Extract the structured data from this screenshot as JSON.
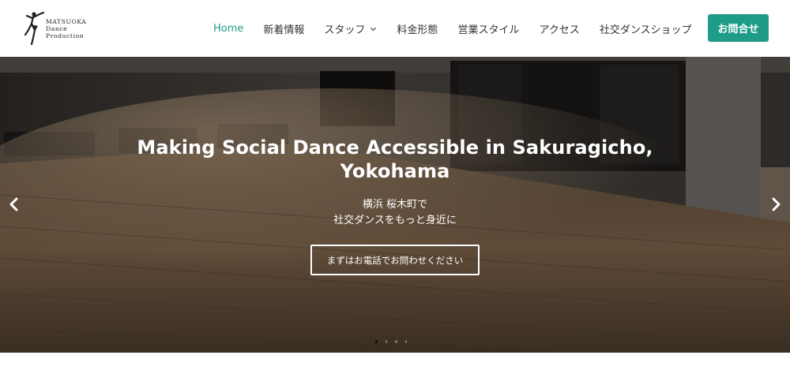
{
  "brand": {
    "line1": "MATSUOKA",
    "line2": "Dance",
    "line3": "Production"
  },
  "nav": {
    "items": [
      {
        "label": "Home"
      },
      {
        "label": "新着情報"
      },
      {
        "label": "スタッフ"
      },
      {
        "label": "料金形態"
      },
      {
        "label": "営業スタイル"
      },
      {
        "label": "アクセス"
      },
      {
        "label": "社交ダンスショップ"
      }
    ],
    "active_color": "#1f9c88",
    "cta_label": "お問合せ",
    "cta_color": "#1f9c88"
  },
  "hero": {
    "title": "Making Social Dance Accessible in Sakuragicho, Yokohama",
    "subtitle_line1": "横浜 桜木町で",
    "subtitle_line2": "社交ダンスをもっと身近に",
    "button_label": "まずはお電話でお問わせください",
    "slide_count": 4,
    "active_slide": 1,
    "prev_icon": "chevron-left-icon",
    "next_icon": "chevron-right-icon"
  }
}
